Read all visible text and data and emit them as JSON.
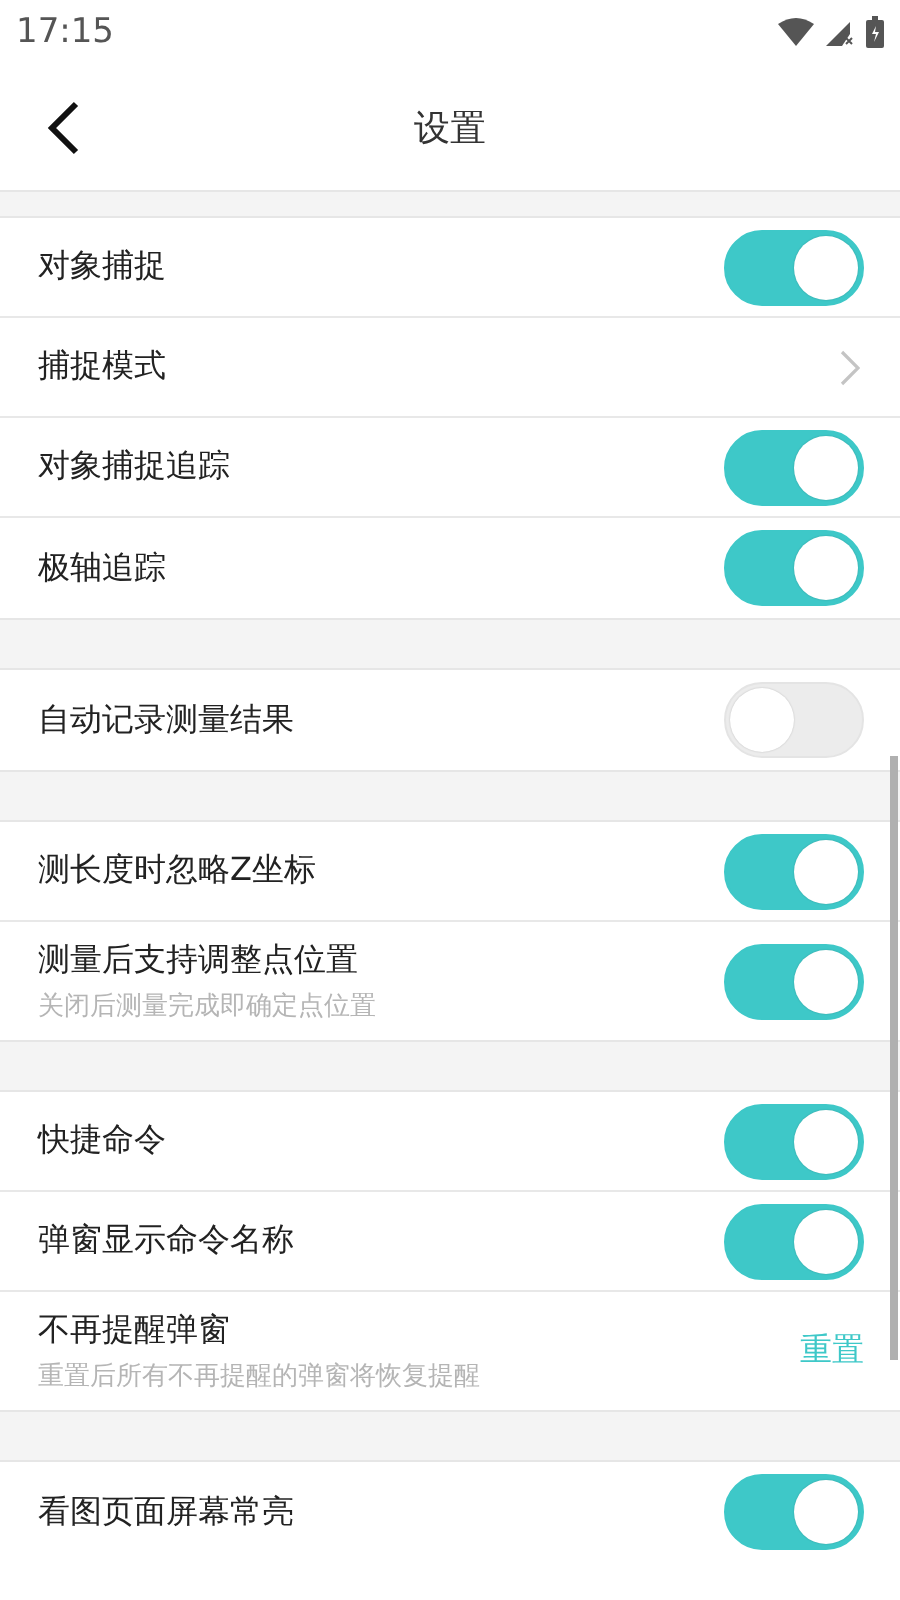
{
  "status_bar": {
    "time": "17:15"
  },
  "header": {
    "title": "设置"
  },
  "groups": [
    {
      "items": [
        {
          "kind": "toggle",
          "label": "对象捕捉",
          "on": true
        },
        {
          "kind": "link",
          "label": "捕捉模式"
        },
        {
          "kind": "toggle",
          "label": "对象捕捉追踪",
          "on": true
        },
        {
          "kind": "toggle",
          "label": "极轴追踪",
          "on": true
        }
      ]
    },
    {
      "items": [
        {
          "kind": "toggle",
          "label": "自动记录测量结果",
          "on": false
        }
      ]
    },
    {
      "items": [
        {
          "kind": "toggle",
          "label": "测长度时忽略Z坐标",
          "on": true
        },
        {
          "kind": "toggle",
          "label": "测量后支持调整点位置",
          "subtitle": "关闭后测量完成即确定点位置",
          "on": true
        }
      ]
    },
    {
      "items": [
        {
          "kind": "toggle",
          "label": "快捷命令",
          "on": true
        },
        {
          "kind": "toggle",
          "label": "弹窗显示命令名称",
          "on": true
        },
        {
          "kind": "action",
          "label": "不再提醒弹窗",
          "subtitle": "重置后所有不再提醒的弹窗将恢复提醒",
          "action": "重置"
        }
      ]
    },
    {
      "items": [
        {
          "kind": "toggle",
          "label": "看图页面屏幕常亮",
          "on": true
        }
      ]
    }
  ]
}
